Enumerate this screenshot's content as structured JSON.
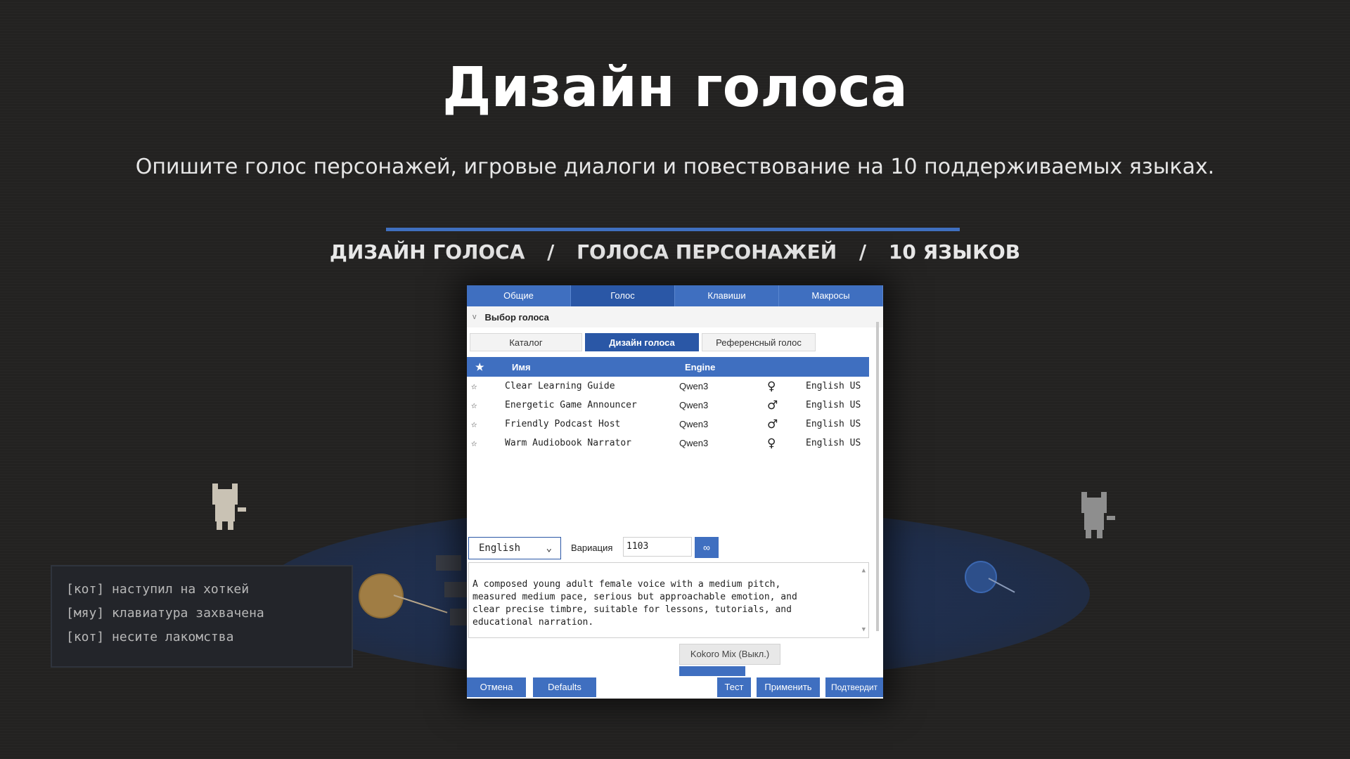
{
  "hero": {
    "title": "Дизайн голоса",
    "subtitle": "Опишите голос персонажей, игровые диалоги и повествование на 10 поддерживаемых языках."
  },
  "feature_strip": {
    "items": [
      "ДИЗАЙН ГОЛОСА",
      "ГОЛОСА ПЕРСОНАЖЕЙ",
      "10 ЯЗЫКОВ"
    ],
    "separator": "/"
  },
  "terminal": {
    "lines": [
      "[кот] наступил на хоткей",
      "[мяу] клавиатура захвачена",
      "[кот] несите лакомства"
    ]
  },
  "window": {
    "tabs": [
      "Общие",
      "Голос",
      "Клавиши",
      "Макросы"
    ],
    "active_tab": "Голос",
    "section": {
      "chevron": "v",
      "title": "Выбор голоса"
    },
    "subtabs": [
      "Каталог",
      "Дизайн голоса",
      "Референсный голос"
    ],
    "list_header": {
      "star": "★",
      "name": "Имя",
      "engine": "Engine"
    },
    "voices": [
      {
        "star": "☆",
        "name": "Clear Learning Guide",
        "engine": "Qwen3",
        "gender": "♀",
        "lang": "English US"
      },
      {
        "star": "☆",
        "name": "Energetic Game Announcer",
        "engine": "Qwen3",
        "gender": "♂",
        "lang": "English US"
      },
      {
        "star": "☆",
        "name": "Friendly Podcast Host",
        "engine": "Qwen3",
        "gender": "♂",
        "lang": "English US"
      },
      {
        "star": "☆",
        "name": "Warm Audiobook Narrator",
        "engine": "Qwen3",
        "gender": "♀",
        "lang": "English US"
      }
    ],
    "language_select": {
      "value": "English",
      "arrow": "⌄"
    },
    "variation": {
      "label": "Вариация",
      "value": "1103",
      "link_icon": "∞"
    },
    "description": "A composed young adult female voice with a medium pitch,\nmeasured medium pace, serious but approachable emotion, and\nclear precise timbre, suitable for lessons, tutorials, and\neducational narration.",
    "kokoro_button": "Kokoro Mix (Выкл.)",
    "buttons": {
      "cancel": "Отмена",
      "defaults": "Defaults",
      "test": "Тест",
      "apply": "Применить",
      "confirm": "Подтвердит"
    }
  },
  "colors": {
    "accent": "#3f6fbf",
    "tab_active": "#2a57a6",
    "background": "#232221"
  }
}
